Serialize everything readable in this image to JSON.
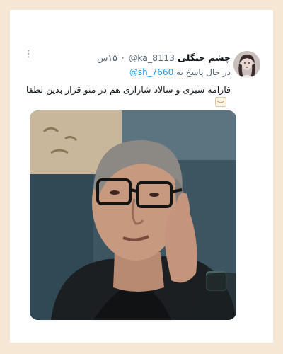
{
  "tweet": {
    "display_name": "چشم جنگلی",
    "handle": "@ka_8113",
    "separator": "·",
    "time": "۱۵س",
    "reply_prefix": "در حال پاسخ به",
    "reply_to": "@sh_7660",
    "text": "قارامه سبزی و سالاد شارازی هم  در منو قرار بدین لطفا",
    "emoji_icon": "pleading-face-icon",
    "more_icon": "vertical-ellipsis-icon",
    "media_description_icon": "photo-icon"
  },
  "colors": {
    "page_background": "#f6e6d4",
    "card": "#ffffff",
    "link": "#1d9bf0",
    "secondary_text": "#536471",
    "primary_text": "#0f1419"
  }
}
